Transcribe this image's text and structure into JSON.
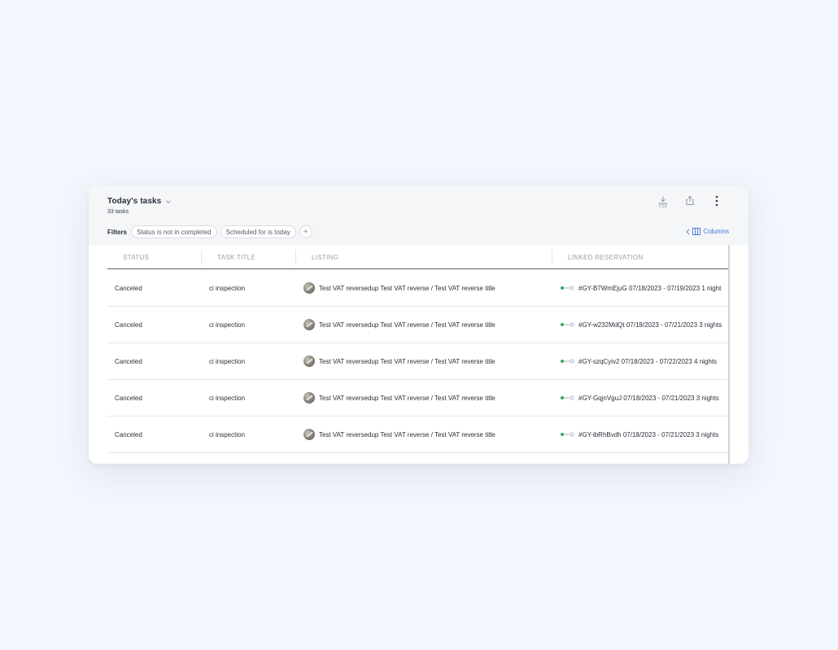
{
  "header": {
    "title": "Today's tasks",
    "subtitle": "33 tasks",
    "csv_label": "CSV"
  },
  "filters": {
    "label": "Filters",
    "chips": [
      "Status is not in completed",
      "Scheduled for is today"
    ],
    "add_label": "+",
    "columns_label": "Columns"
  },
  "table": {
    "columns": [
      "STATUS",
      "TASK TITLE",
      "LISTING",
      "LINKED RESERVATION"
    ],
    "rows": [
      {
        "status": "Canceled",
        "title": "ci inspection",
        "listing": "Test VAT reversedup Test VAT reverse / Test VAT reverse title",
        "reservation": "#GY-B7WmEjuG  07/18/2023  -  07/19/2023  1 night"
      },
      {
        "status": "Canceled",
        "title": "ci inspection",
        "listing": "Test VAT reversedup Test VAT reverse / Test VAT reverse title",
        "reservation": "#GY-w232MdQt  07/18/2023  -  07/21/2023  3 nights"
      },
      {
        "status": "Canceled",
        "title": "ci inspection",
        "listing": "Test VAT reversedup Test VAT reverse / Test VAT reverse title",
        "reservation": "#GY-szqCyiv2  07/18/2023  -  07/22/2023  4 nights"
      },
      {
        "status": "Canceled",
        "title": "ci inspection",
        "listing": "Test VAT reversedup Test VAT reverse / Test VAT reverse title",
        "reservation": "#GY-GqjnVguJ  07/18/2023  -  07/21/2023  3 nights"
      },
      {
        "status": "Canceled",
        "title": "ci inspection",
        "listing": "Test VAT reversedup Test VAT reverse / Test VAT reverse title",
        "reservation": "#GY-ibRhBvdh  07/18/2023  -  07/21/2023  3 nights"
      }
    ]
  },
  "colors": {
    "accent": "#3d74d6",
    "background": "#f3f6fc",
    "header_bg": "#f5f6f8",
    "reservation_dot": "#3aa35a"
  },
  "icons": {
    "title_dropdown": "chevron-down-icon",
    "export": "download-csv-icon",
    "share": "share-icon",
    "more": "more-vertical-icon",
    "columns": "columns-icon",
    "columns_back": "chevron-left-icon",
    "listing_thumb": "listing-thumbnail-icon",
    "reservation_status": "reservation-timeline-icon"
  }
}
